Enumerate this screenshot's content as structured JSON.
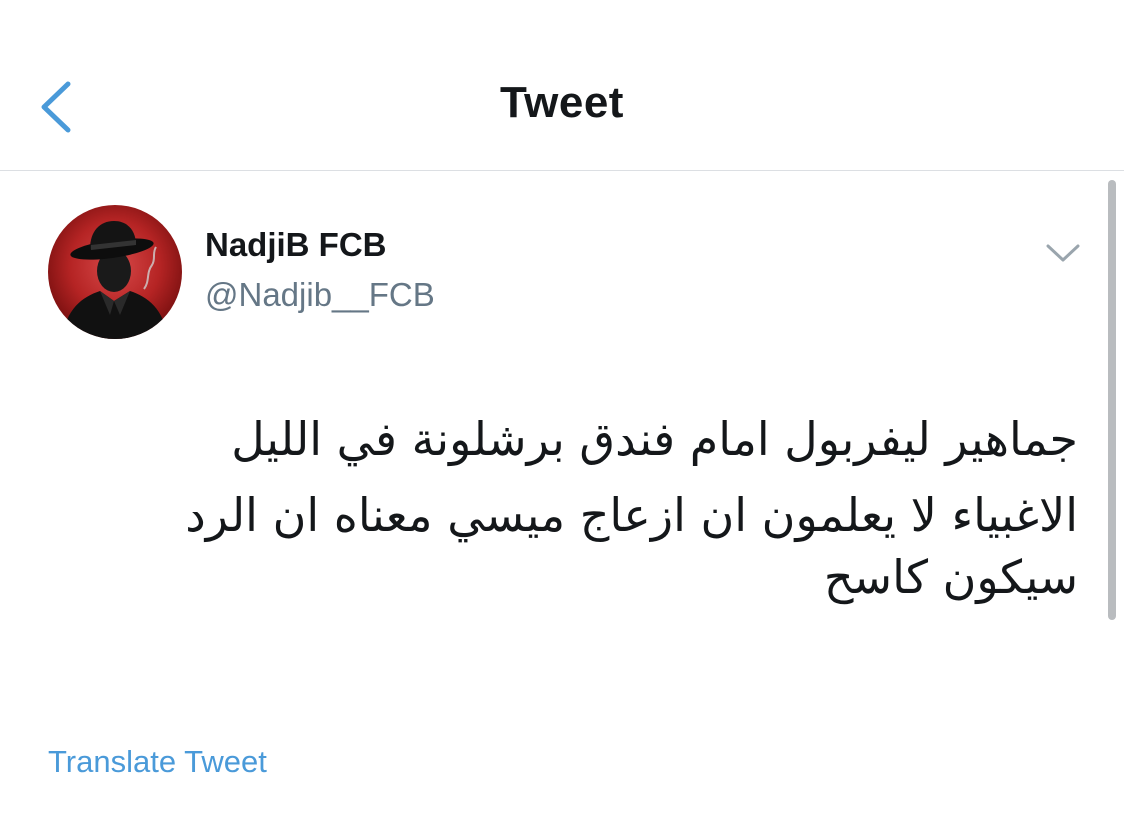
{
  "header": {
    "title": "Tweet",
    "back_icon": "chevron-left-icon"
  },
  "tweet": {
    "user": {
      "name": "NadjiB FCB",
      "handle": "@Nadjib__FCB",
      "avatar": "avatar-man-in-hat-silhouette"
    },
    "more_icon": "chevron-down-icon",
    "paragraphs": [
      "جماهير ليفربول امام فندق برشلونة في الليل",
      "الاغبياء لا يعلمون ان ازعاج ميسي معناه ان الرد سيكون كاسح"
    ],
    "translate_label": "Translate Tweet"
  },
  "colors": {
    "accent": "#4a9ad9",
    "text_primary": "#14171a",
    "text_secondary": "#657786",
    "divider": "#dcdfe3"
  }
}
